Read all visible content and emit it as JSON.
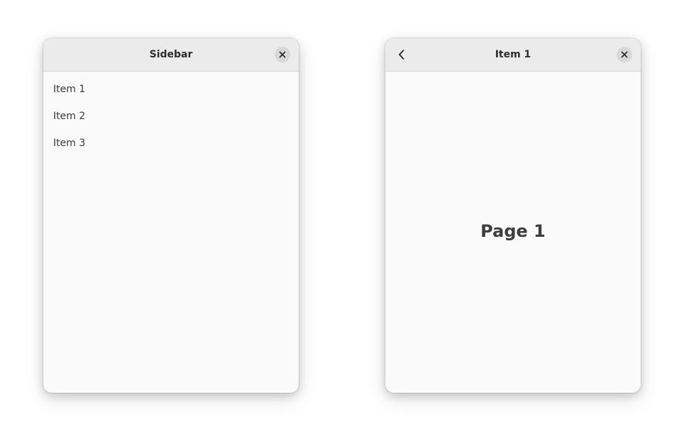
{
  "sidebar_window": {
    "title": "Sidebar",
    "items": [
      {
        "label": "Item 1"
      },
      {
        "label": "Item 2"
      },
      {
        "label": "Item 3"
      }
    ],
    "close_icon": "close-icon"
  },
  "content_window": {
    "title": "Item 1",
    "page_label": "Page 1",
    "back_icon": "chevron-left-icon",
    "close_icon": "close-icon"
  },
  "colors": {
    "headerbar": "#ebebeb",
    "window_bg": "#fafafa",
    "close_button_bg": "#d8d8d8",
    "text": "#2e2e2e"
  }
}
